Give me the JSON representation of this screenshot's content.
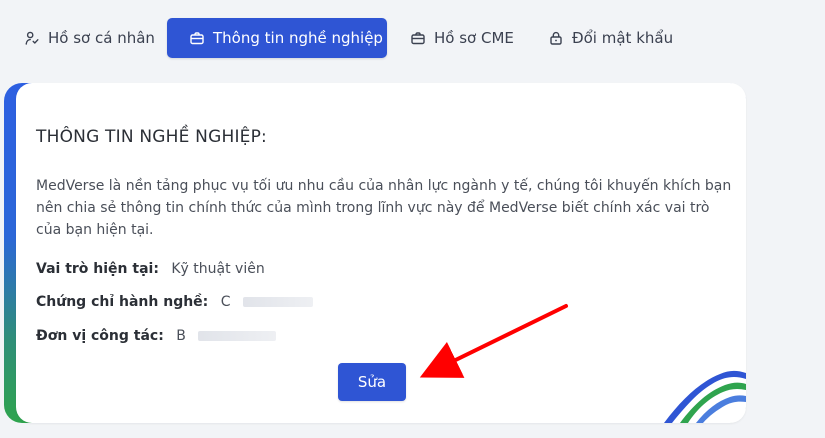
{
  "tabs": [
    {
      "label": "Hồ sơ cá nhân",
      "icon": "user-check-icon"
    },
    {
      "label": "Thông tin nghề nghiệp",
      "icon": "briefcase-icon"
    },
    {
      "label": "Hồ sơ CME",
      "icon": "briefcase-icon"
    },
    {
      "label": "Đổi mật khẩu",
      "icon": "lock-icon"
    }
  ],
  "card": {
    "title": "THÔNG TIN NGHỀ NGHIỆP:",
    "description": "MedVerse là nền tảng phục vụ tối ưu nhu cầu của nhân lực ngành y tế, chúng tôi khuyến khích bạn nên chia sẻ thông tin chính thức của mình trong lĩnh vực này để MedVerse biết chính xác vai trò của bạn hiện tại.",
    "fields": [
      {
        "label": "Vai trò hiện tại:",
        "value": "Kỹ thuật viên"
      },
      {
        "label": "Chứng chỉ hành nghề:",
        "value": "C"
      },
      {
        "label": "Đơn vị công tác:",
        "value": "B"
      }
    ],
    "edit_button_label": "Sửa"
  },
  "colors": {
    "primary": "#2f55d4",
    "background": "#f2f4f7",
    "arrow": "#ff0000",
    "accent_green": "#2fa44e"
  }
}
